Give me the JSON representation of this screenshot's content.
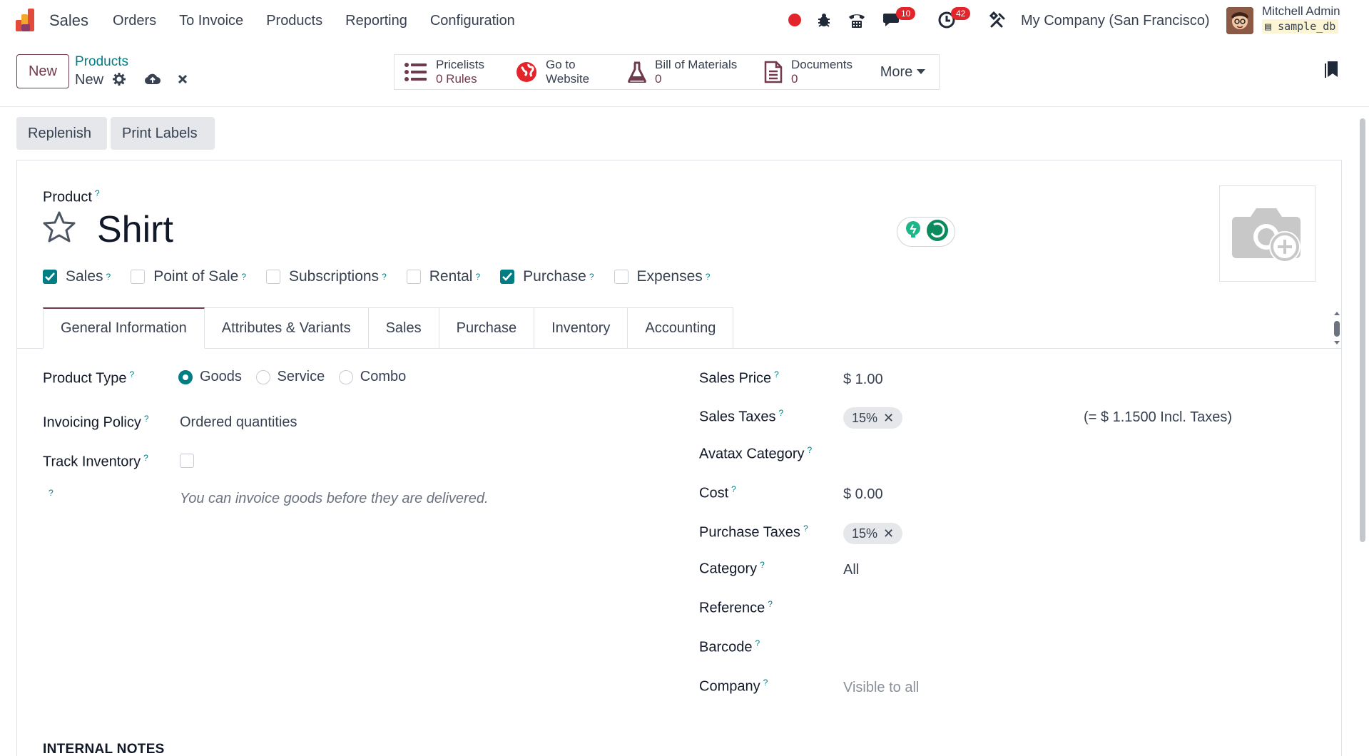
{
  "navbar": {
    "app_name": "Sales",
    "menu": [
      "Orders",
      "To Invoice",
      "Products",
      "Reporting",
      "Configuration"
    ],
    "messages_count": "10",
    "activities_count": "42",
    "company": "My Company (San Francisco)",
    "user_name": "Mitchell Admin",
    "db_name": "sample_db"
  },
  "control": {
    "new_label": "New",
    "breadcrumb_parent": "Products",
    "breadcrumb_current": "New",
    "smart_buttons": [
      {
        "line1": "Pricelists",
        "line2": "0  Rules"
      },
      {
        "line1": "Go to",
        "line2": "Website"
      },
      {
        "line1": "Bill of Materials",
        "line2": "0"
      },
      {
        "line1": "Documents",
        "line2": "0"
      }
    ],
    "more_label": "More"
  },
  "actions": {
    "replenish": "Replenish",
    "print_labels": "Print Labels"
  },
  "form": {
    "product_label": "Product",
    "product_name": "Shirt",
    "checkboxes": [
      {
        "label": "Sales",
        "checked": true
      },
      {
        "label": "Point of Sale",
        "checked": false
      },
      {
        "label": "Subscriptions",
        "checked": false
      },
      {
        "label": "Rental",
        "checked": false
      },
      {
        "label": "Purchase",
        "checked": true
      },
      {
        "label": "Expenses",
        "checked": false
      }
    ],
    "tabs": [
      "General Information",
      "Attributes & Variants",
      "Sales",
      "Purchase",
      "Inventory",
      "Accounting"
    ],
    "left": {
      "product_type_label": "Product Type",
      "product_type_options": [
        "Goods",
        "Service",
        "Combo"
      ],
      "invoicing_policy_label": "Invoicing Policy",
      "invoicing_policy_value": "Ordered quantities",
      "track_inventory_label": "Track Inventory",
      "hint": "You can invoice goods before they are delivered."
    },
    "right": {
      "sales_price_label": "Sales Price",
      "sales_price_value": "$ 1.00",
      "sales_taxes_label": "Sales Taxes",
      "sales_tax_tag": "15%",
      "incl_taxes": "(= $ 1.1500 Incl. Taxes)",
      "avatax_label": "Avatax Category",
      "cost_label": "Cost",
      "cost_value": "$ 0.00",
      "purchase_taxes_label": "Purchase Taxes",
      "purchase_tax_tag": "15%",
      "category_label": "Category",
      "category_value": "All",
      "reference_label": "Reference",
      "barcode_label": "Barcode",
      "company_label": "Company",
      "company_placeholder": "Visible to all"
    },
    "internal_notes": "INTERNAL NOTES"
  },
  "colors": {
    "brand": "#71394e",
    "accent": "#017e84",
    "badge": "#e3242b"
  }
}
